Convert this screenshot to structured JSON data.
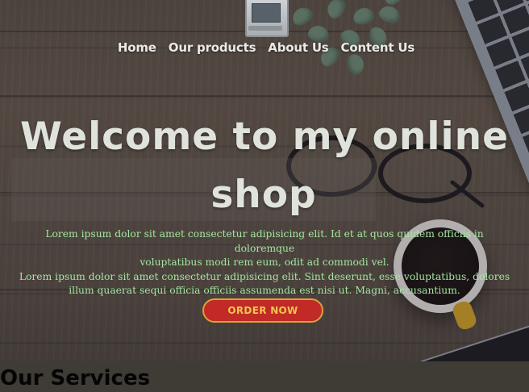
{
  "nav": {
    "logo_icon": "laptop-icon",
    "items": [
      "Home",
      "Our products",
      "About Us",
      "Content Us"
    ]
  },
  "hero": {
    "title_line1": "Welcome to my online",
    "title_line2": "shop",
    "paragraph_line1": "Lorem ipsum dolor sit amet consectetur adipisicing elit. Id et at quos quidem officiis in doloremque",
    "paragraph_line2": "voluptatibus modi rem eum, odit ad commodi vel.",
    "paragraph_line3": "Lorem ipsum dolor sit amet consectetur adipisicing elit. Sint deserunt, esse voluptatibus, dolores",
    "paragraph_line4": "illum quaerat sequi officia officiis assumenda est nisi ut. Magni, accusantium.",
    "order_button": "ORDER NOW"
  },
  "services": {
    "heading": "Our Services"
  },
  "colors": {
    "title_text": "#dfe3dc",
    "paragraph_text": "#a3e6a0",
    "button_bg": "#c12a26",
    "button_border": "#d8a23a",
    "button_text": "#f0c54e",
    "nav_text": "#e9e9e6"
  }
}
